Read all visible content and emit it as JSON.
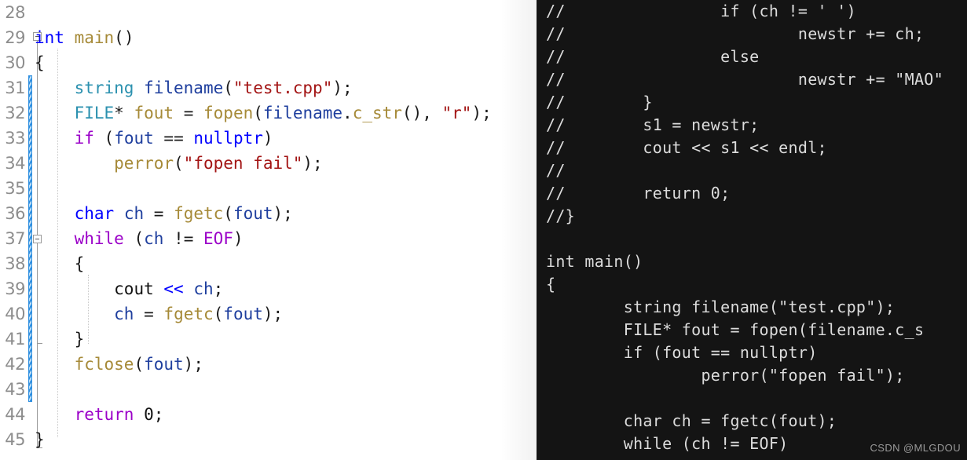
{
  "editor": {
    "first_line_number": 28,
    "gutter_change_marker_color": "#2f8fe0",
    "background": "#ffffff",
    "lines": [
      {
        "num": "28",
        "text": ""
      },
      {
        "num": "29",
        "text": "int main()"
      },
      {
        "num": "30",
        "text": "{"
      },
      {
        "num": "31",
        "text": "    string filename(\"test.cpp\");"
      },
      {
        "num": "32",
        "text": "    FILE* fout = fopen(filename.c_str(), \"r\");"
      },
      {
        "num": "33",
        "text": "    if (fout == nullptr)"
      },
      {
        "num": "34",
        "text": "        perror(\"fopen fail\");"
      },
      {
        "num": "35",
        "text": ""
      },
      {
        "num": "36",
        "text": "    char ch = fgetc(fout);"
      },
      {
        "num": "37",
        "text": "    while (ch != EOF)"
      },
      {
        "num": "38",
        "text": "    {"
      },
      {
        "num": "39",
        "text": "        cout << ch;"
      },
      {
        "num": "40",
        "text": "        ch = fgetc(fout);"
      },
      {
        "num": "41",
        "text": "    }"
      },
      {
        "num": "42",
        "text": "    fclose(fout);"
      },
      {
        "num": "43",
        "text": ""
      },
      {
        "num": "44",
        "text": "    return 0;"
      },
      {
        "num": "45",
        "text": "}"
      }
    ]
  },
  "console": {
    "background": "#141414",
    "text_color": "#dcdcdc",
    "lines": [
      "//                if (ch != ' ')",
      "//                        newstr += ch;",
      "//                else",
      "//                        newstr += \"MAO\"",
      "//        }",
      "//        s1 = newstr;",
      "//        cout << s1 << endl;",
      "//",
      "//        return 0;",
      "//}",
      "",
      "int main()",
      "{",
      "        string filename(\"test.cpp\");",
      "        FILE* fout = fopen(filename.c_s",
      "        if (fout == nullptr)",
      "                perror(\"fopen fail\");",
      "",
      "        char ch = fgetc(fout);",
      "        while (ch != EOF)"
    ]
  },
  "watermark": {
    "text": "CSDN @MLGDOU"
  }
}
